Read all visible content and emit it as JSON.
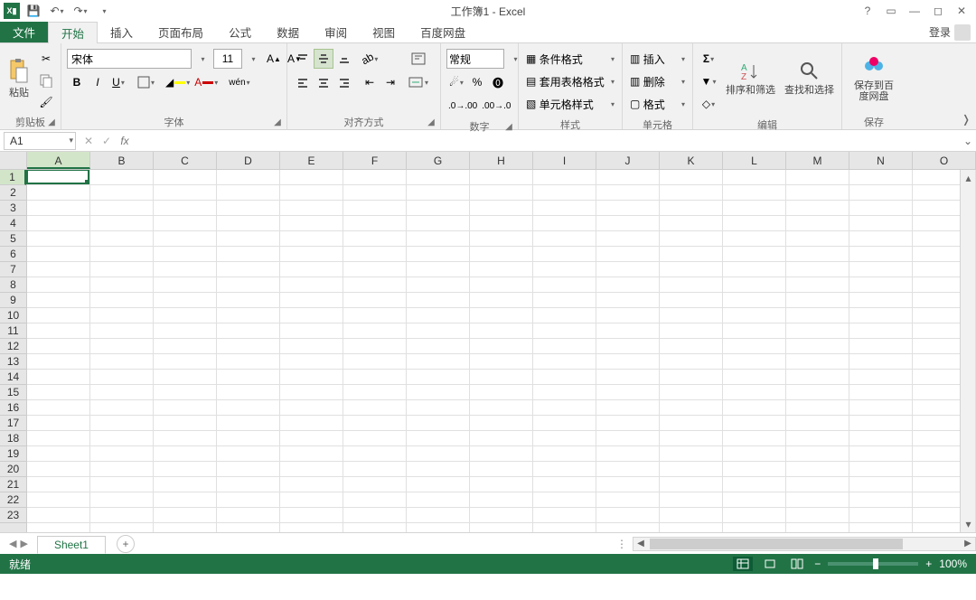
{
  "title": "工作簿1 - Excel",
  "signin_label": "登录",
  "tabs": {
    "file": "文件",
    "items": [
      "开始",
      "插入",
      "页面布局",
      "公式",
      "数据",
      "审阅",
      "视图",
      "百度网盘"
    ],
    "active_index": 0
  },
  "ribbon": {
    "clipboard": {
      "label": "剪贴板",
      "paste": "粘贴"
    },
    "font": {
      "label": "字体",
      "name": "宋体",
      "size": "11"
    },
    "alignment": {
      "label": "对齐方式"
    },
    "number": {
      "label": "数字",
      "format": "常规"
    },
    "styles": {
      "label": "样式",
      "cond_fmt": "条件格式",
      "table_fmt": "套用表格格式",
      "cell_style": "单元格样式"
    },
    "cells": {
      "label": "单元格",
      "insert": "插入",
      "delete": "删除",
      "format": "格式"
    },
    "editing": {
      "label": "编辑",
      "sort_filter": "排序和筛选",
      "find_select": "查找和选择"
    },
    "save": {
      "label": "保存",
      "save_to": "保存到百度网盘"
    }
  },
  "formula_bar": {
    "cell_ref": "A1",
    "formula": ""
  },
  "grid": {
    "columns": [
      "A",
      "B",
      "C",
      "D",
      "E",
      "F",
      "G",
      "H",
      "I",
      "J",
      "K",
      "L",
      "M",
      "N",
      "O"
    ],
    "rows": [
      1,
      2,
      3,
      4,
      5,
      6,
      7,
      8,
      9,
      10,
      11,
      12,
      13,
      14,
      15,
      16,
      17,
      18,
      19,
      20,
      21,
      22,
      23
    ],
    "active": {
      "col": 0,
      "row": 0
    }
  },
  "sheets": {
    "active": "Sheet1"
  },
  "status": {
    "ready": "就绪",
    "zoom": "100%"
  }
}
